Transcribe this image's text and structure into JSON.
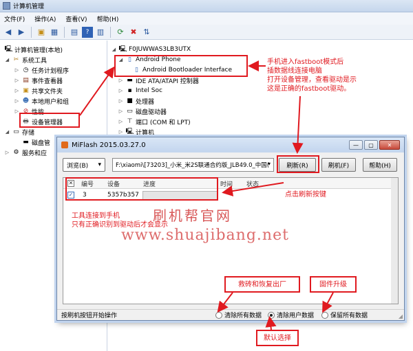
{
  "window": {
    "title": "计算机管理"
  },
  "menu": [
    "文件(F)",
    "操作(A)",
    "查看(V)",
    "帮助(H)"
  ],
  "left_tree": {
    "root": "计算机管理(本地)",
    "system_tools": "系统工具",
    "task_scheduler": "任务计划程序",
    "event_viewer": "事件查看器",
    "shared_folders": "共享文件夹",
    "local_users": "本地用户和组",
    "performance": "性能",
    "device_manager": "设备管理器",
    "storage": "存储",
    "disk_mgmt": "磁盘管",
    "services": "服务和应"
  },
  "device_tree": {
    "computer": "F0JUWWAS3LB3UTX",
    "android_phone": "Android Phone",
    "android_bootloader": "Android Bootloader Interface",
    "ide": "IDE ATA/ATAPI 控制器",
    "intel_soc": "Intel Soc",
    "processor": "处理器",
    "disk_drives": "磁盘驱动器",
    "ports": "端口 (COM 和 LPT)",
    "computer_node": "计算机"
  },
  "annotations": {
    "fastboot_note": [
      "手机进入fastboot模式后",
      "插数据线连接电脑",
      "打开设备管理，查看驱动是示",
      "这是正确的fastboot驱动。"
    ],
    "refresh_note": "点击刷新按键",
    "connect_note": [
      "工具连接到手机",
      "只有正确识别到驱动后才会显示"
    ],
    "unbrick_note": "救砖和恢复出厂",
    "firmware_note": "固件升级",
    "default_note": "默认选择"
  },
  "watermark": {
    "cn": "刷机帮官网",
    "url": "www.shuajibang.net"
  },
  "miflash": {
    "title": "MiFlash 2015.03.27.0",
    "browse_label": "浏览(B)",
    "path": "F:\\xiaomi\\[73203]_小米_米2S联通合约版_JLB49.0_中国(",
    "refresh_label": "刷新(R)",
    "flash_label": "刷机(F)",
    "help_label": "帮助(H)",
    "columns": [
      "编号",
      "设备",
      "进度",
      "时间",
      "状态"
    ],
    "rows": [
      {
        "id": "3",
        "device": "5357b357",
        "progress": 0
      }
    ],
    "status_text": "按刷机按钮开始操作",
    "options": [
      "清除所有数据",
      "清除用户数据",
      "保留所有数据"
    ],
    "selected_option": 1
  }
}
